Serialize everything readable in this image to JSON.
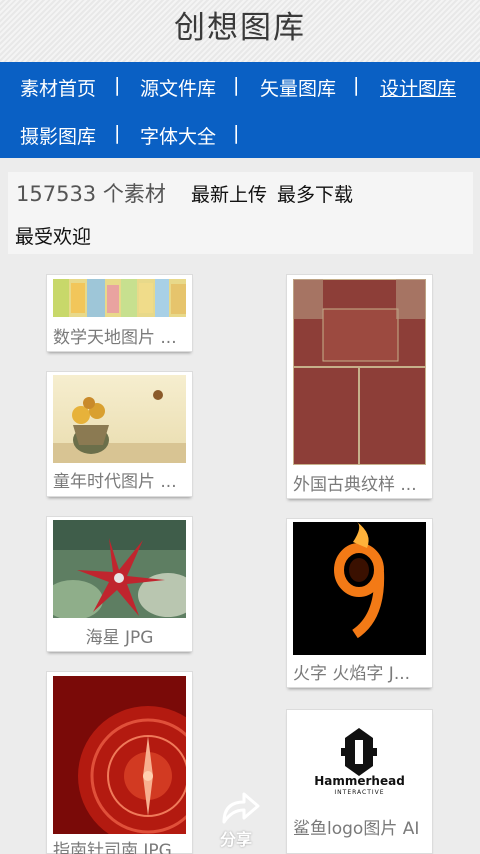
{
  "header": {
    "title": "创想图库"
  },
  "nav": {
    "row1": [
      {
        "label": "素材首页"
      },
      {
        "label": "源文件库"
      },
      {
        "label": "矢量图库"
      },
      {
        "label": "设计图库",
        "active": true
      }
    ],
    "row2": [
      {
        "label": "摄影图库"
      },
      {
        "label": "字体大全"
      }
    ],
    "separator": "|"
  },
  "info": {
    "count": "157533 个素材",
    "sort_newest": "最新上传",
    "sort_downloads": "最多下载",
    "sort_popular": "最受欢迎"
  },
  "cards": {
    "c1": {
      "caption": "数学天地图片 ..."
    },
    "c2": {
      "caption": "童年时代图片 ..."
    },
    "c3": {
      "caption": "海星 JPG"
    },
    "c4": {
      "caption": "指南针司南 JPG"
    },
    "c5": {
      "caption": "外国古典纹样 ..."
    },
    "c6": {
      "caption": "火字 火焰字 J..."
    },
    "c7": {
      "caption": "鲨鱼logo图片 AI",
      "logo_text": "Hammerhead",
      "logo_sub": "INTERACTIVE"
    }
  },
  "share": {
    "label": "分享",
    "icon": "share-arrow-icon"
  },
  "colors": {
    "nav_bg": "#0a60c4",
    "page_bg": "#ececec"
  }
}
